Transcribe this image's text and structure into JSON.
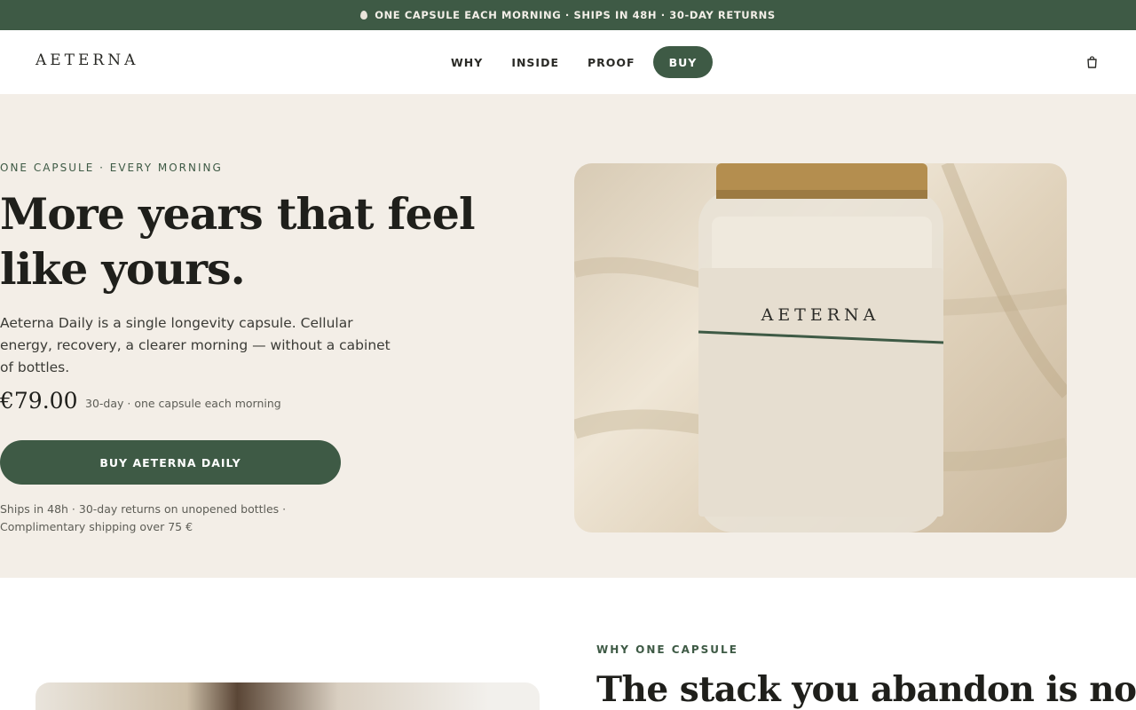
{
  "announcement": {
    "text": "ONE CAPSULE EACH MORNING · SHIPS IN 48H · 30-DAY RETURNS",
    "icon": "drop-icon"
  },
  "header": {
    "logo": "AETERNA",
    "nav": [
      {
        "label": "WHY"
      },
      {
        "label": "INSIDE"
      },
      {
        "label": "PROOF"
      },
      {
        "label": "BUY"
      }
    ],
    "cart_icon": "shopping-bag-icon"
  },
  "hero": {
    "eyebrow": "ONE CAPSULE · EVERY MORNING",
    "headline": "More years that feel like yours.",
    "subcopy": "Aeterna Daily is a single longevity capsule. Cellular energy, recovery, a clearer morning — without a cabinet of bottles.",
    "price": "€79.00",
    "price_note": "30-day · one capsule each morning",
    "cta": "BUY AETERNA DAILY",
    "fine_print": "Ships in 48h · 30-day returns on unopened bottles · Complimentary shipping over 75 €",
    "jar_label": "AETERNA"
  },
  "section_why": {
    "eyebrow": "WHY ONE CAPSULE",
    "title": "The stack you abandon is not a"
  },
  "colors": {
    "brand_green": "#3e5a45",
    "hero_bg": "#f3eee7"
  }
}
